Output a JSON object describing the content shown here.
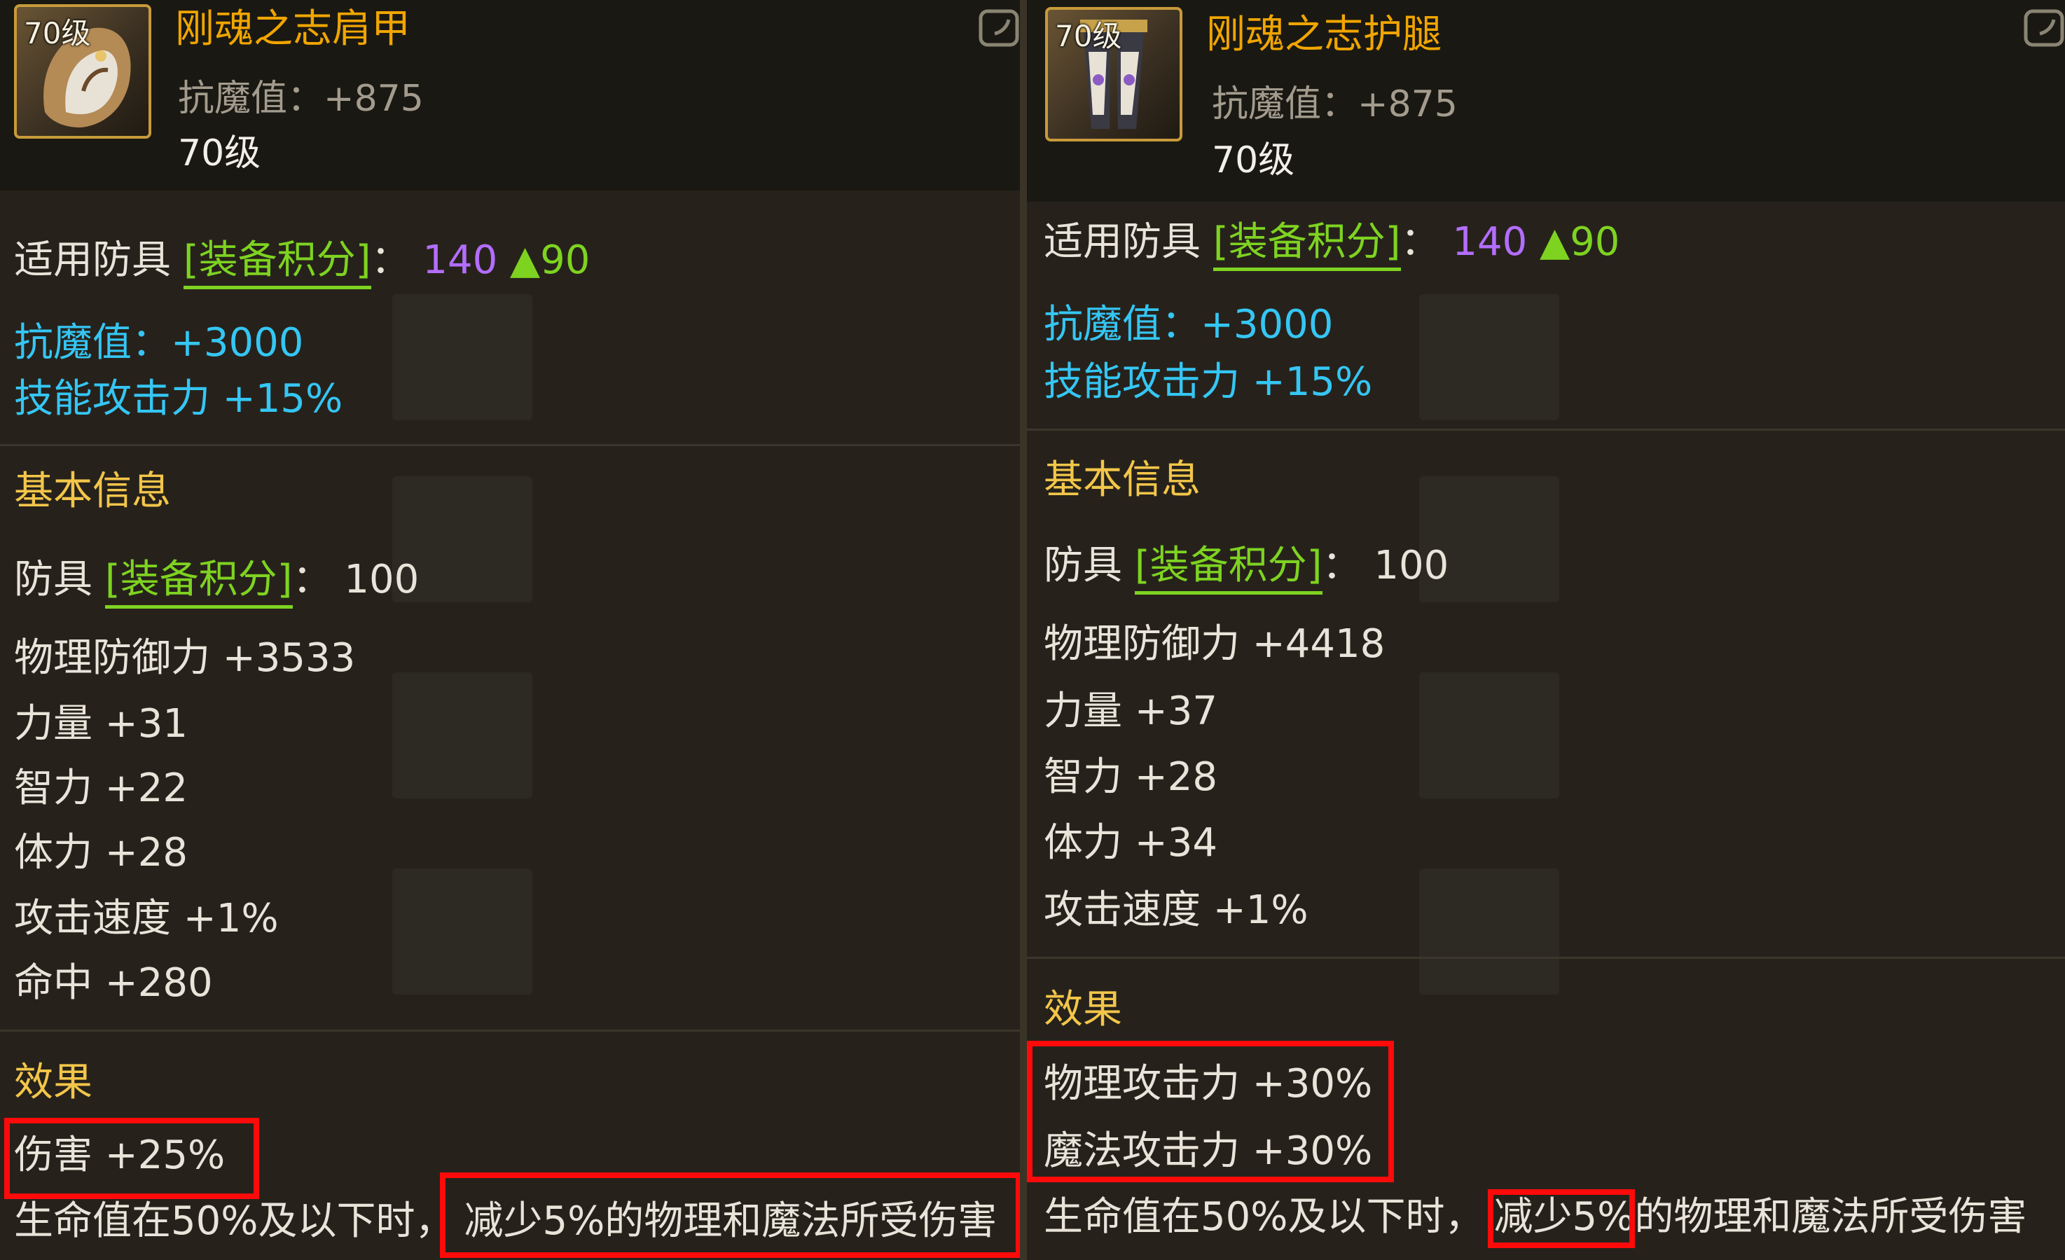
{
  "left": {
    "icon_level": "70级",
    "name": "刚魂之志肩甲",
    "magic_res_label": "抗魔值：",
    "magic_res_value": "+875",
    "level": "70级",
    "applicable_label": "适用防具",
    "score_tag": "[装备积分]",
    "colon": "：",
    "score_value": "140",
    "score_up": "▲90",
    "bonus_magic_res": "抗魔值：+3000",
    "bonus_skill_atk": "技能攻击力 +15%",
    "basic_info_heading": "基本信息",
    "armor_label": "防具",
    "armor_score": "100",
    "stats": [
      "物理防御力 +3533",
      "力量 +31",
      "智力 +22",
      "体力 +28",
      "攻击速度 +1%",
      "命中 +280"
    ],
    "effect_heading": "效果",
    "effects": [
      "伤害 +25%"
    ],
    "hp_effect_prefix": "生命值在50%及以下时，",
    "hp_effect_main": "减少5%的物理和魔法所受伤害"
  },
  "right": {
    "icon_level": "70级",
    "name": "刚魂之志护腿",
    "magic_res_label": "抗魔值：",
    "magic_res_value": "+875",
    "level": "70级",
    "applicable_label": "适用防具",
    "score_tag": "[装备积分]",
    "colon": "：",
    "score_value": "140",
    "score_up": "▲90",
    "bonus_magic_res": "抗魔值：+3000",
    "bonus_skill_atk": "技能攻击力 +15%",
    "basic_info_heading": "基本信息",
    "armor_label": "防具",
    "armor_score": "100",
    "stats": [
      "物理防御力 +4418",
      "力量 +37",
      "智力 +28",
      "体力 +34",
      "攻击速度 +1%"
    ],
    "effect_heading": "效果",
    "effects": [
      "物理攻击力 +30%",
      "魔法攻击力 +30%"
    ],
    "hp_effect_prefix": "生命值在50%及以下时，",
    "hp_effect_highlight": "减少5%",
    "hp_effect_suffix": "的物理和魔法所受伤害"
  },
  "colors": {
    "name": "#f0a500",
    "green_tag": "#7ed321",
    "purple_score": "#b36dff",
    "cyan_bonus": "#35c6f4",
    "gold_heading": "#f3c64a",
    "highlight_box": "#ff0a0a"
  },
  "icons": {
    "left_item": "shoulder-armor-icon",
    "right_item": "leg-armor-icon",
    "corner": "compare-toggle-icon"
  }
}
